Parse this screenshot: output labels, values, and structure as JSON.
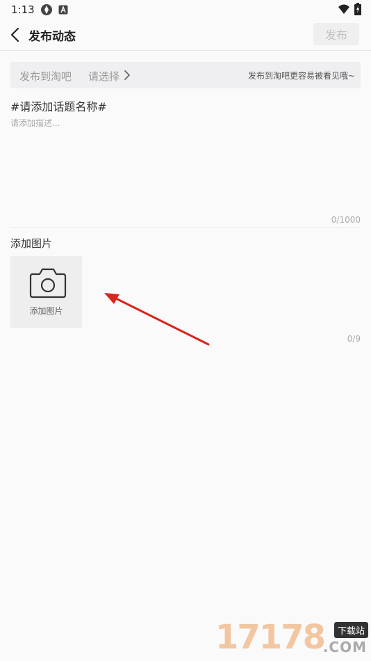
{
  "status_bar": {
    "time": "1:13"
  },
  "header": {
    "title": "发布动态",
    "publish_label": "发布"
  },
  "bar_selector": {
    "label": "发布到淘吧",
    "value": "请选择",
    "hint": "发布到淘吧更容易被看见哦~"
  },
  "composer": {
    "topic_placeholder": "#请添加话题名称#",
    "description_placeholder": "请添加描述...",
    "char_count": "0/1000"
  },
  "images": {
    "section_title": "添加图片",
    "tile_label": "添加图片",
    "count": "0/9"
  },
  "watermark": {
    "digits": "17178",
    "badge": "下载站",
    "domain": ".COM"
  },
  "colors": {
    "arrow": "#d9251d",
    "publish_disabled_text": "#c2c2c2"
  }
}
